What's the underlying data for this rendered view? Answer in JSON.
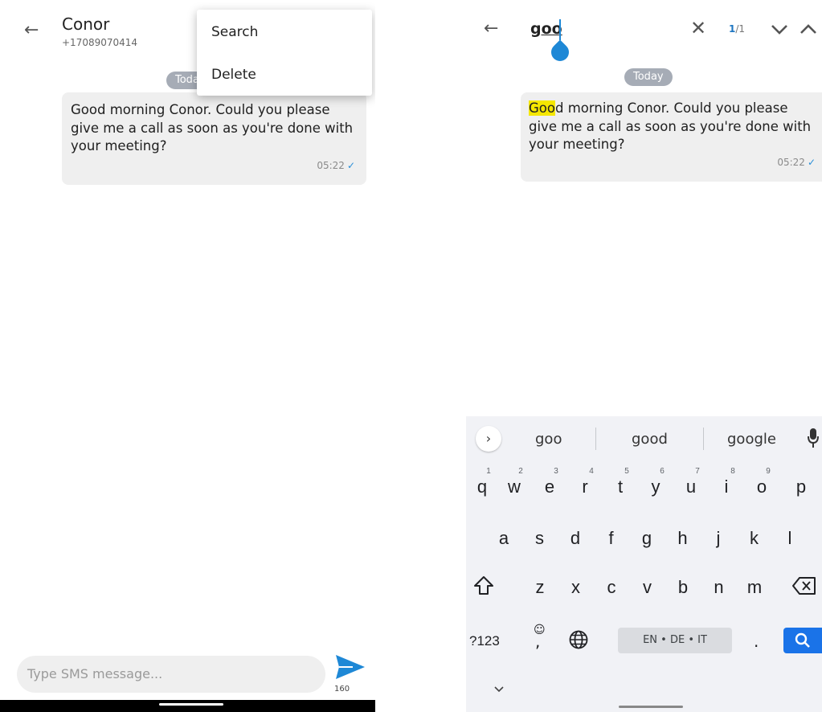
{
  "left": {
    "contact": {
      "name": "Conor",
      "phone": "+17089070414"
    },
    "date_chip": "Today",
    "message": {
      "text": "Good morning Conor. Could you please give me a call as soon as you're done with your meeting?",
      "time": "05:22"
    },
    "menu": {
      "items": [
        {
          "label": "Search"
        },
        {
          "label": "Delete"
        }
      ]
    },
    "composer": {
      "placeholder": "Type SMS message...",
      "char_count": "160"
    }
  },
  "right": {
    "search": {
      "query": "goo",
      "match_current": "1",
      "match_total": "/1"
    },
    "date_chip": "Today",
    "message": {
      "highlight": "Goo",
      "rest": "d morning Conor. Could you please give me a call as soon as you're done with your meeting?",
      "time": "05:22"
    },
    "keyboard": {
      "suggestions": [
        "goo",
        "good",
        "google"
      ],
      "row1": [
        {
          "key": "q",
          "hint": "1"
        },
        {
          "key": "w",
          "hint": "2"
        },
        {
          "key": "e",
          "hint": "3"
        },
        {
          "key": "r",
          "hint": "4"
        },
        {
          "key": "t",
          "hint": "5"
        },
        {
          "key": "y",
          "hint": "6"
        },
        {
          "key": "u",
          "hint": "7"
        },
        {
          "key": "i",
          "hint": "8"
        },
        {
          "key": "o",
          "hint": "9"
        },
        {
          "key": "p",
          "hint": ""
        }
      ],
      "row2": [
        "a",
        "s",
        "d",
        "f",
        "g",
        "h",
        "j",
        "k",
        "l"
      ],
      "row3": [
        "z",
        "x",
        "c",
        "v",
        "b",
        "n",
        "m"
      ],
      "symbols_label": "?123",
      "comma_label": ",",
      "period_label": ".",
      "space_label": "EN • DE • IT"
    }
  },
  "colors": {
    "accent": "#1e88d6",
    "highlight": "#f5e700",
    "bubble": "#efefef",
    "chip": "#a6acb6",
    "keyboard_bg": "#f1f2f6"
  }
}
